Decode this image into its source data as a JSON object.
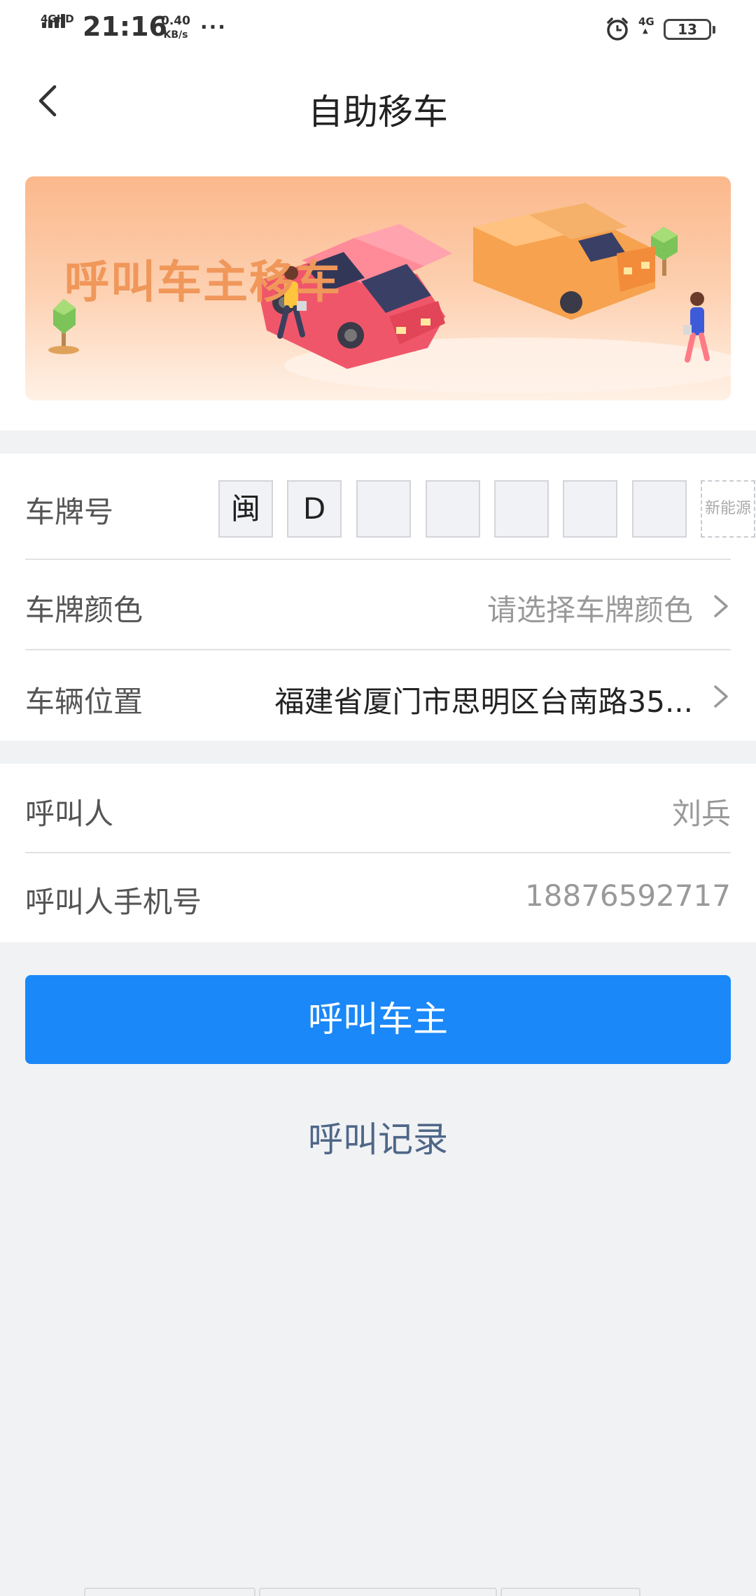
{
  "status_bar": {
    "network_label": "4GHD",
    "time": "21:16",
    "speed_value": "0.40",
    "speed_unit": "KB/s",
    "more": "···",
    "network_right": "4G",
    "battery": "13"
  },
  "nav": {
    "title": "自助移车"
  },
  "banner": {
    "text": "呼叫车主移车"
  },
  "form": {
    "plate_label": "车牌号",
    "plate_chars": [
      "闽",
      "D",
      "",
      "",
      "",
      "",
      ""
    ],
    "new_energy_label": "新能源",
    "plate_color_label": "车牌颜色",
    "plate_color_placeholder": "请选择车牌颜色",
    "location_label": "车辆位置",
    "location_value": "福建省厦门市思明区台南路35..."
  },
  "caller": {
    "name_label": "呼叫人",
    "name_value": "刘兵",
    "phone_label": "呼叫人手机号",
    "phone_value": "18876592717"
  },
  "actions": {
    "call_button": "呼叫车主",
    "records_link": "呼叫记录"
  },
  "colors": {
    "primary": "#1a88f8",
    "banner_text": "#f0975a",
    "link": "#4f6688"
  }
}
